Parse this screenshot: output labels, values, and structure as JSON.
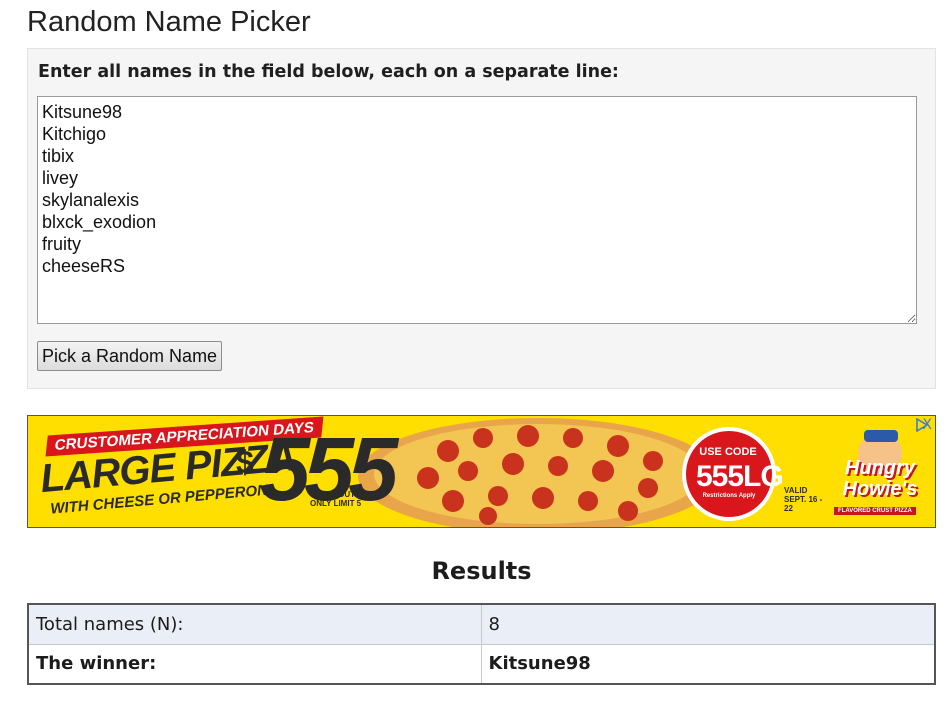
{
  "page": {
    "title": "Random Name Picker"
  },
  "input_panel": {
    "instructions": "Enter all names in the field below, each on a separate line:",
    "names": [
      "Kitsune98",
      "Kitchigo",
      "tibix",
      "livey",
      "skylanalexis",
      "blxck_exodion",
      "fruity",
      "cheeseRS"
    ],
    "button_label": "Pick a Random Name"
  },
  "ad": {
    "banner": "CRUSTOMER APPRECIATION DAYS",
    "headline": "LARGE PIZZA",
    "subline": "WITH CHEESE OR PEPPERONI",
    "currency": "$",
    "price": "555",
    "carryout": "CARRYOUT ONLY LIMIT 5",
    "use_code_label": "USE CODE",
    "code": "555LG",
    "restrictions": "Restrictions Apply",
    "valid": "VALID SEPT. 16 - 22",
    "brand": "Hungry Howie's",
    "brand_tagline": "FLAVORED CRUST PIZZA",
    "close_glyph": "X",
    "colors": {
      "background": "#ffdf00",
      "red": "#d9161c",
      "dark": "#2a2a2a"
    }
  },
  "results": {
    "title": "Results",
    "rows": [
      {
        "label": "Total names (N):",
        "value": "8"
      },
      {
        "label": "The winner:",
        "value": "Kitsune98"
      }
    ]
  }
}
